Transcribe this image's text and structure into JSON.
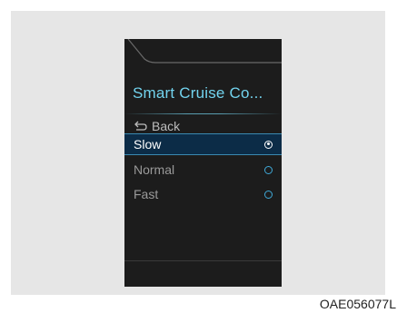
{
  "screen": {
    "title": "Smart Cruise Co...",
    "back_label": "Back",
    "options": [
      {
        "label": "Slow",
        "selected": true
      },
      {
        "label": "Normal",
        "selected": false
      },
      {
        "label": "Fast",
        "selected": false
      }
    ],
    "accent_color": "#72d3ee",
    "selected_bg_color": "#0c2c47"
  },
  "figure_code": "OAE056077L"
}
